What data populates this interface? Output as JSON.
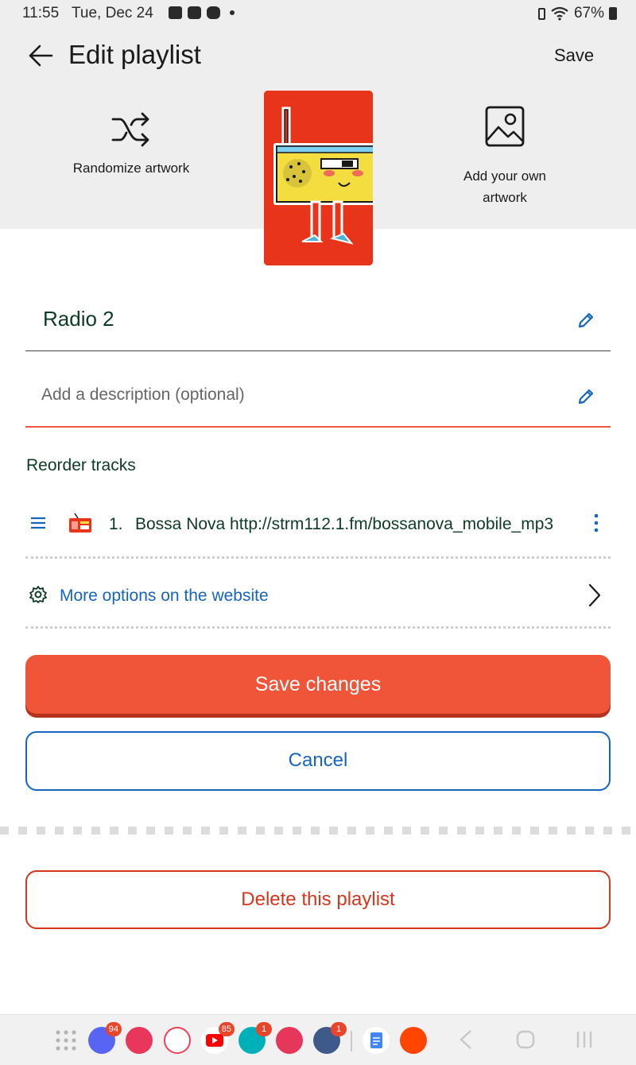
{
  "status_bar": {
    "time": "11:55",
    "date": "Tue, Dec 24",
    "battery": "67%"
  },
  "header": {
    "title": "Edit playlist",
    "save_label": "Save",
    "randomize_label": "Randomize artwork",
    "add_artwork_label": "Add your own artwork"
  },
  "form": {
    "name_value": "Radio 2",
    "description_placeholder": "Add a description (optional)",
    "reorder_label": "Reorder tracks"
  },
  "tracks": [
    {
      "number": "1.",
      "title": "Bossa Nova http://strm112.1.fm/bossanova_mobile_mp3"
    }
  ],
  "more_options_label": "More options on the website",
  "buttons": {
    "save_changes": "Save changes",
    "cancel": "Cancel",
    "delete": "Delete this playlist"
  },
  "taskbar": {
    "apps": [
      {
        "name": "app-drawer-icon"
      },
      {
        "name": "discord-icon",
        "badge": "94",
        "color": "#5865f2"
      },
      {
        "name": "app-red-icon",
        "color": "#e8375a"
      },
      {
        "name": "pocket-icon",
        "color": "#ef4056"
      },
      {
        "name": "youtube-icon",
        "badge": "85",
        "color": "#ff0000"
      },
      {
        "name": "fitbit-icon",
        "badge": "1",
        "color": "#00b0b9"
      },
      {
        "name": "camera-app-icon",
        "color": "#e6375a"
      },
      {
        "name": "settings-icon",
        "badge": "1",
        "color": "#3d5a8a"
      },
      {
        "name": "google-docs-icon",
        "color": "#4285f4"
      },
      {
        "name": "reddit-icon",
        "color": "#ff4500"
      }
    ]
  },
  "colors": {
    "accent_orange": "#f0553a",
    "link_blue": "#1565c0",
    "delete_red": "#d9341c",
    "text_green": "#0e3b25"
  }
}
